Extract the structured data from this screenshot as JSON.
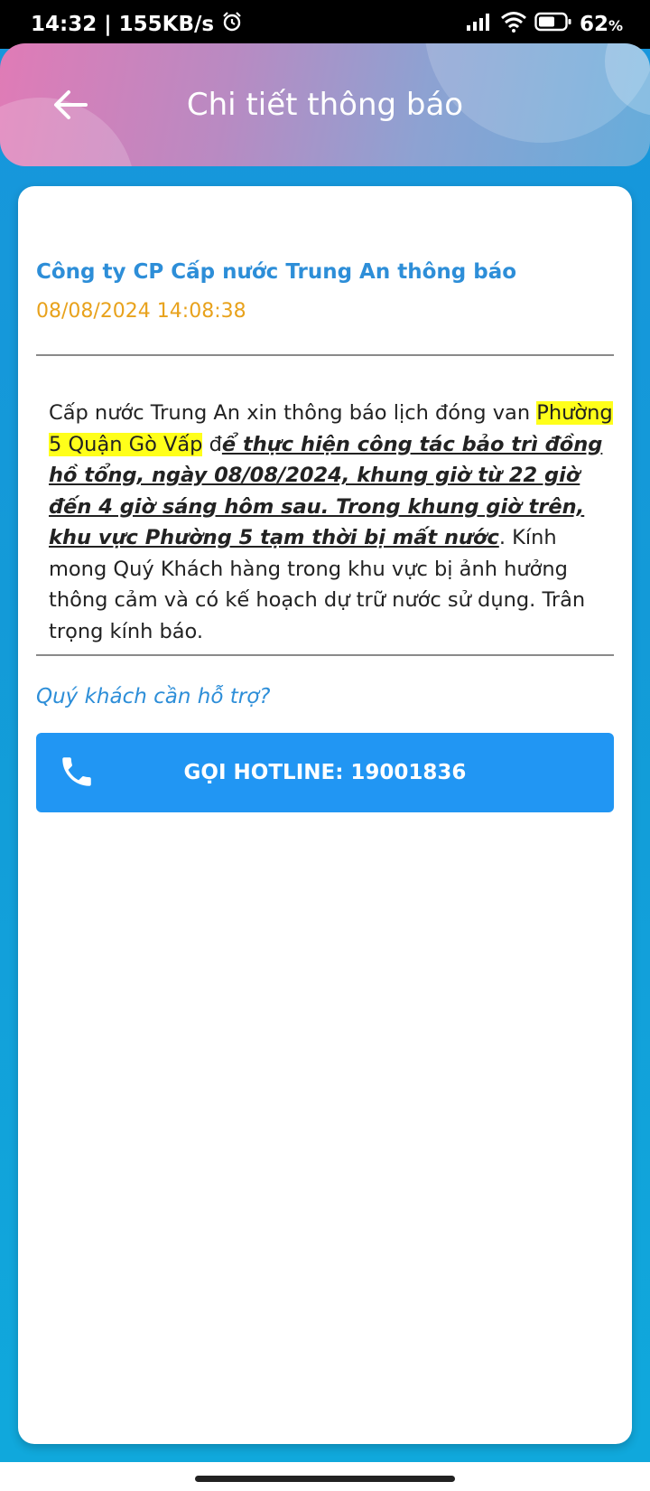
{
  "status_bar": {
    "time": "14:32",
    "speed": "| 155KB/s",
    "battery": "62",
    "battery_unit": "%",
    "icons": [
      "alarm-icon",
      "signal-icon",
      "wifi-icon",
      "battery-icon"
    ]
  },
  "header": {
    "title": "Chi tiết thông báo",
    "back_icon": "arrow-left-icon"
  },
  "notification": {
    "sender": "Công ty CP Cấp nước Trung An thông báo",
    "date": "08/08/2024 14:08:38",
    "message": {
      "part1": "Cấp nước Trung An xin thông báo lịch đóng van ",
      "highlight": "Phường 5 Quận Gò Vấp",
      "part2": " đ",
      "emphasis": "ể thực hiện công tác bảo trì đồng hồ tổng, ngày 08/08/2024, khung giờ từ 22 giờ đến 4 giờ sáng hôm sau. Trong khung giờ trên, khu vực Phường 5 tạm thời bị mất nước",
      "part3": ". Kính mong Quý Khách hàng trong khu vực bị ảnh hưởng thông cảm và có kế hoạch dự trữ nước sử dụng. Trân trọng kính báo."
    }
  },
  "support": {
    "question": "Quý khách cần hỗ trợ?",
    "hotline_label": "GỌI HOTLINE: 19001836",
    "phone_icon": "phone-icon"
  },
  "colors": {
    "accent": "#2196f3",
    "sender": "#2d8ed8",
    "date": "#e8a21c",
    "highlight": "#ffff1a"
  }
}
